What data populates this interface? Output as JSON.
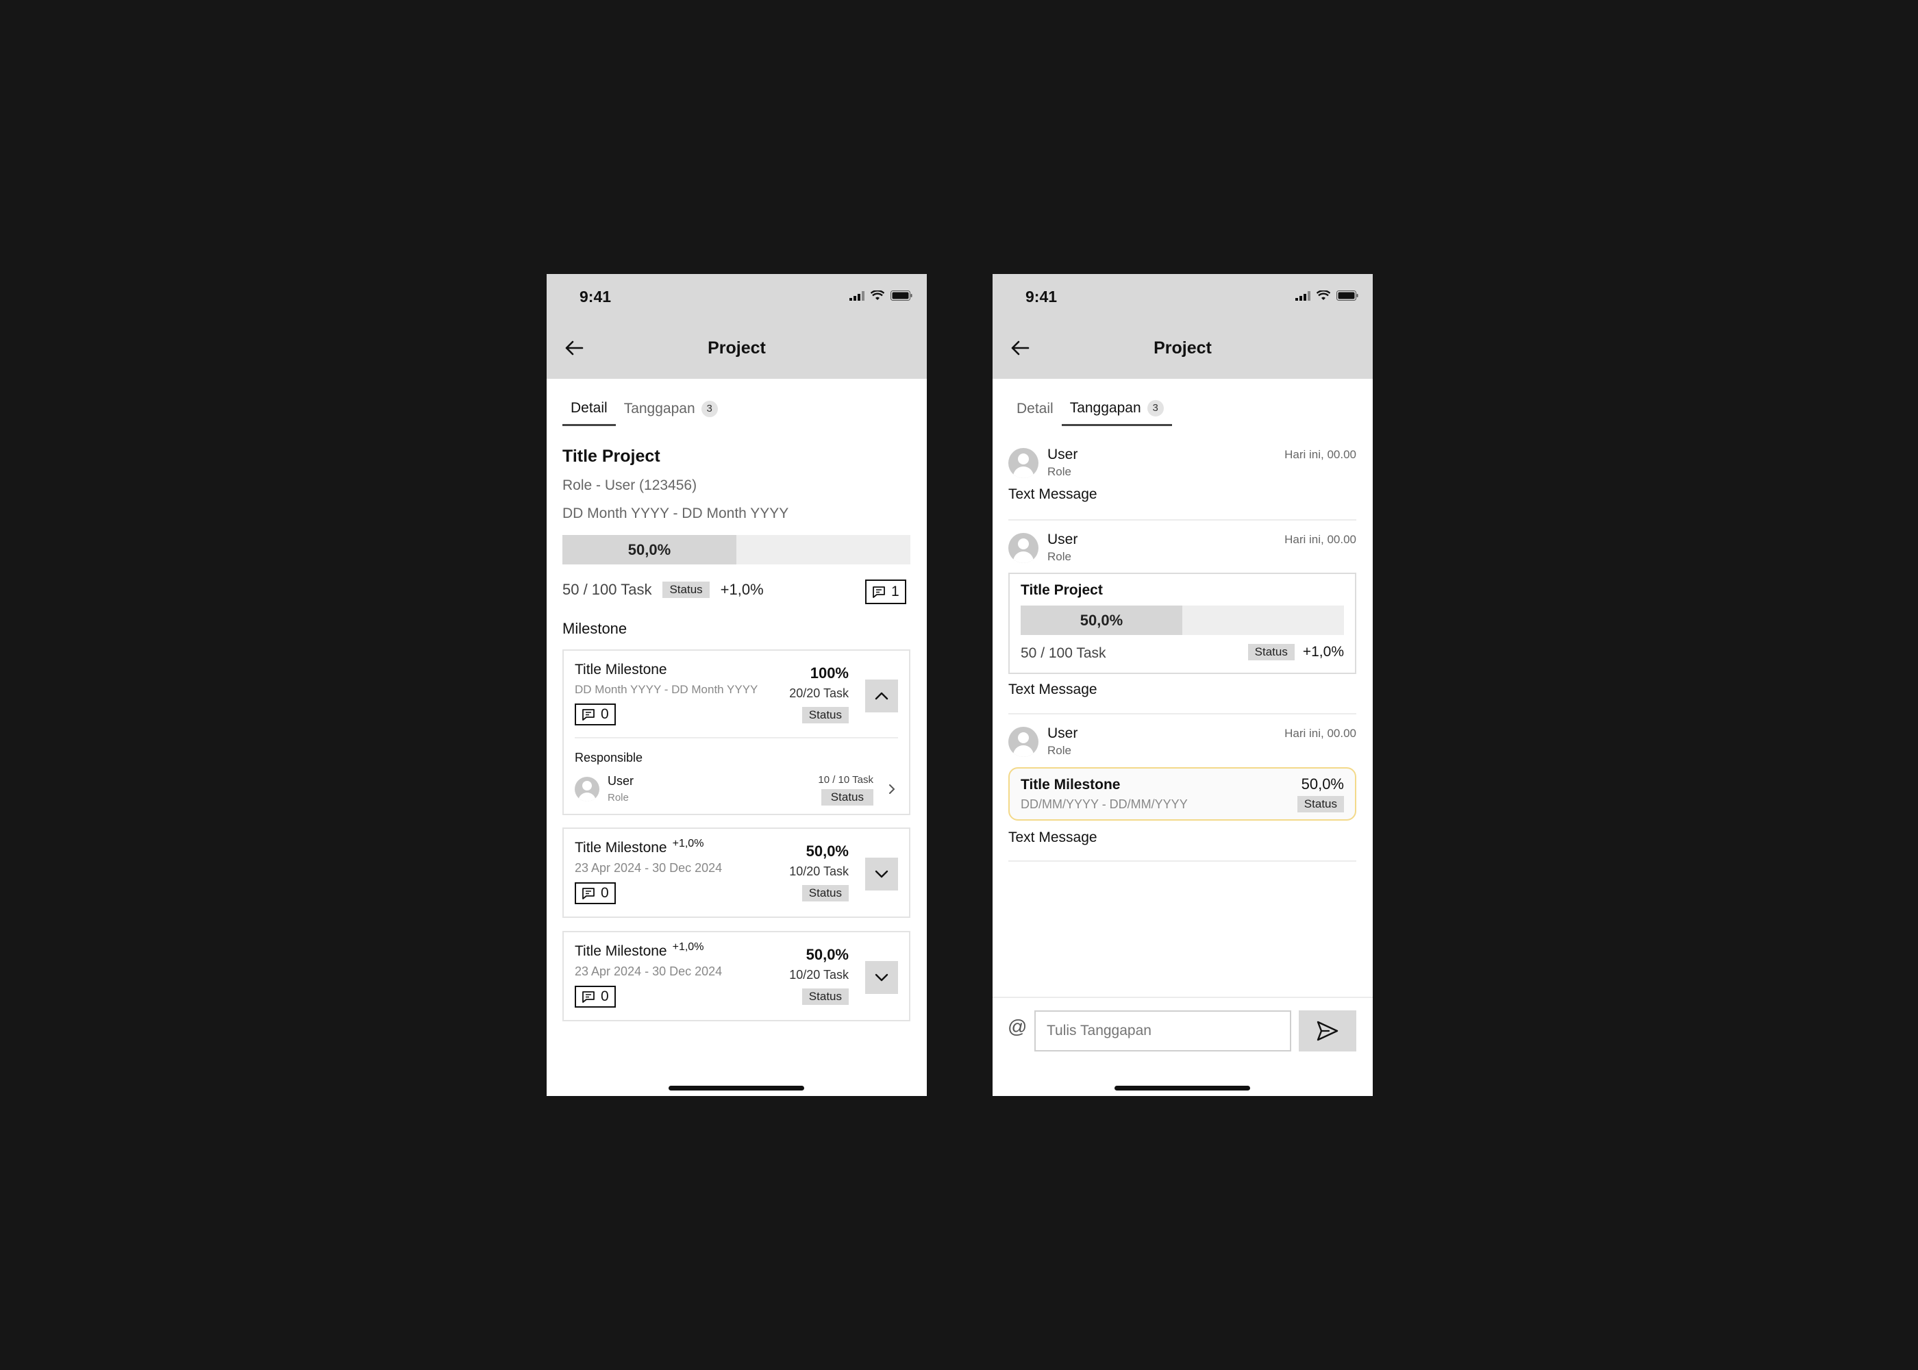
{
  "status_bar": {
    "time": "9:41"
  },
  "nav": {
    "title": "Project"
  },
  "tabs": {
    "detail": "Detail",
    "tanggapan": "Tanggapan",
    "tanggapan_count": "3"
  },
  "detail": {
    "title": "Title Project",
    "role_line": "Role -  User (123456)",
    "date_range": "DD Month YYYY - DD Month YYYY",
    "progress": {
      "value": 0.5,
      "label": "50,0%"
    },
    "task": "50 / 100 Task",
    "status": "Status",
    "delta": "+1,0%",
    "comment_count": "1",
    "milestone_heading": "Milestone",
    "milestones": [
      {
        "title": "Title Milestone",
        "delta": "",
        "date": "DD Month YYYY - DD Month YYYY",
        "comments": "0",
        "percent": "100%",
        "tasks": "20/20 Task",
        "status": "Status",
        "expanded": true,
        "responsible_label": "Responsible",
        "responsible": {
          "name": "User",
          "role": "Role",
          "tasks": "10 / 10 Task",
          "status": "Status"
        }
      },
      {
        "title": "Title Milestone",
        "delta": "+1,0%",
        "date": "23 Apr 2024 - 30 Dec 2024",
        "comments": "0",
        "percent": "50,0%",
        "tasks": "10/20 Task",
        "status": "Status",
        "expanded": false
      },
      {
        "title": "Title Milestone",
        "delta": "+1,0%",
        "date": "23 Apr 2024 - 30 Dec 2024",
        "comments": "0",
        "percent": "50,0%",
        "tasks": "10/20 Task",
        "status": "Status",
        "expanded": false
      }
    ]
  },
  "tanggapan": {
    "messages": [
      {
        "user": "User",
        "role": "Role",
        "time": "Hari ini, 00.00",
        "text": "Text Message"
      },
      {
        "user": "User",
        "role": "Role",
        "time": "Hari ini, 00.00",
        "text": "Text Message",
        "attachment": {
          "title": "Title Project",
          "progress": {
            "value": 0.5,
            "label": "50,0%"
          },
          "task": "50 / 100 Task",
          "status": "Status",
          "delta": "+1,0%"
        }
      },
      {
        "user": "User",
        "role": "Role",
        "time": "Hari ini, 00.00",
        "text": "Text Message",
        "milestone_ref": {
          "title": "Title Milestone",
          "date": "DD/MM/YYYY - DD/MM/YYYY",
          "percent": "50,0%",
          "status": "Status"
        }
      }
    ],
    "composer": {
      "at_symbol": "@",
      "placeholder": "Tulis Tanggapan"
    }
  },
  "colors": {
    "background": "#161616",
    "header_gray": "#d9d9d9",
    "highlight_border": "#f3d98a"
  }
}
